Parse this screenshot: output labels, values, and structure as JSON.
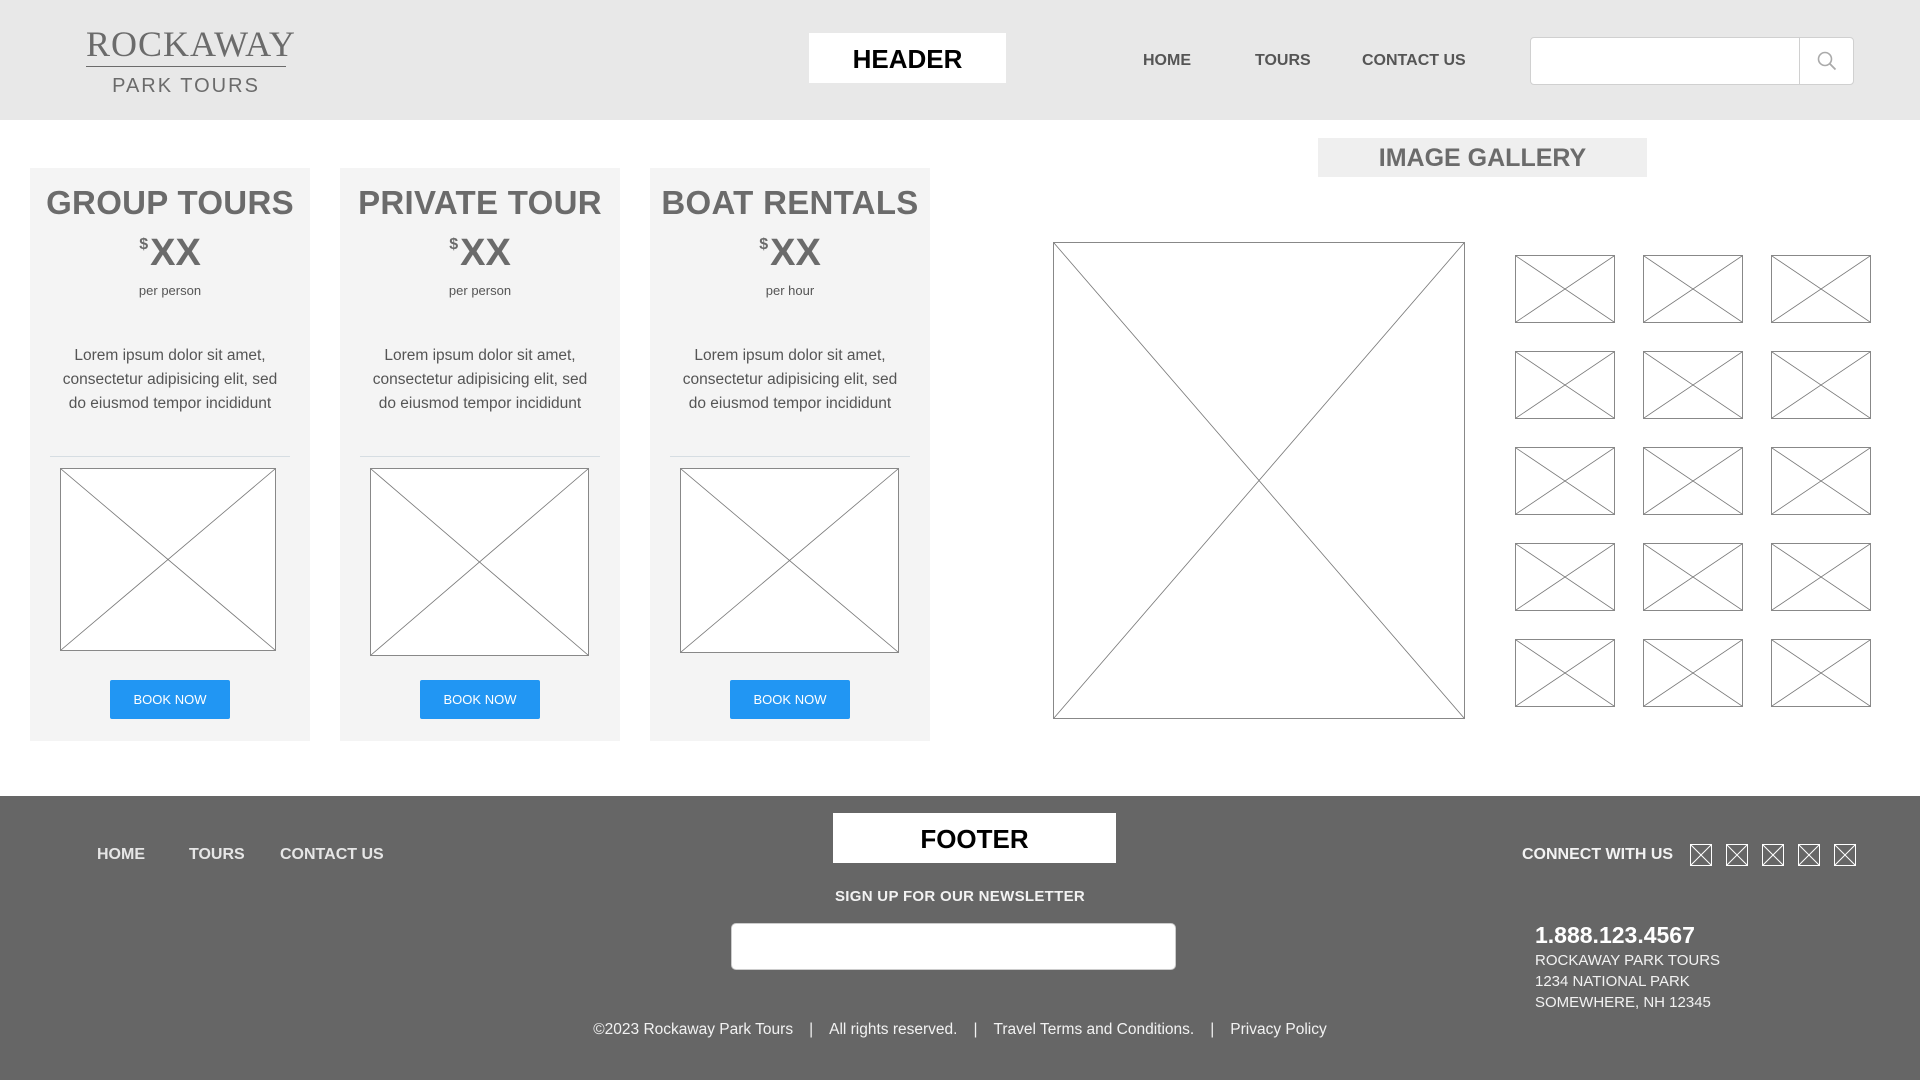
{
  "header": {
    "logo_main": "ROCKAWAY",
    "logo_sub": "PARK TOURS",
    "label": "HEADER",
    "nav": [
      "HOME",
      "TOURS",
      "CONTACT US"
    ],
    "search_placeholder": "",
    "search_icon": "search-icon"
  },
  "cards": [
    {
      "title": "GROUP TOURS",
      "currency": "$",
      "price": "XX",
      "unit": "per person",
      "description": "Lorem ipsum dolor sit amet, consectetur adipisicing elit, sed do eiusmod tempor incididunt",
      "button": "BOOK NOW"
    },
    {
      "title": "PRIVATE TOUR",
      "currency": "$",
      "price": "XX",
      "unit": "per person",
      "description": "Lorem ipsum dolor sit amet, consectetur adipisicing elit, sed do eiusmod tempor incididunt",
      "button": "BOOK NOW"
    },
    {
      "title": "BOAT RENTALS",
      "currency": "$",
      "price": "XX",
      "unit": "per hour",
      "description": "Lorem ipsum dolor sit amet, consectetur adipisicing elit, sed do eiusmod tempor incididunt",
      "button": "BOOK NOW"
    }
  ],
  "gallery": {
    "title": "IMAGE GALLERY"
  },
  "footer": {
    "label": "FOOTER",
    "nav": [
      "HOME",
      "TOURS",
      "CONTACT US"
    ],
    "newsletter_label": "SIGN UP FOR OUR NEWSLETTER",
    "newsletter_placeholder": "",
    "connect": "CONNECT WITH US",
    "social_icons": [
      "social-icon-1",
      "social-icon-2",
      "social-icon-3",
      "social-icon-4",
      "social-icon-5"
    ],
    "phone": "1.888.123.4567",
    "address": [
      "ROCKAWAY PARK TOURS",
      "1234 NATIONAL PARK",
      "SOMEWHERE, NH 12345"
    ],
    "copyright": "©2023 Rockaway Park Tours",
    "rights": "All rights reserved.",
    "terms": "Travel Terms and Conditions.",
    "privacy": "Privacy Policy",
    "separator": "|"
  },
  "colors": {
    "header_bg": "#e8e8e8",
    "footer_bg": "#666666",
    "accent": "#2196f3",
    "card_bg": "#f4f4f4"
  }
}
